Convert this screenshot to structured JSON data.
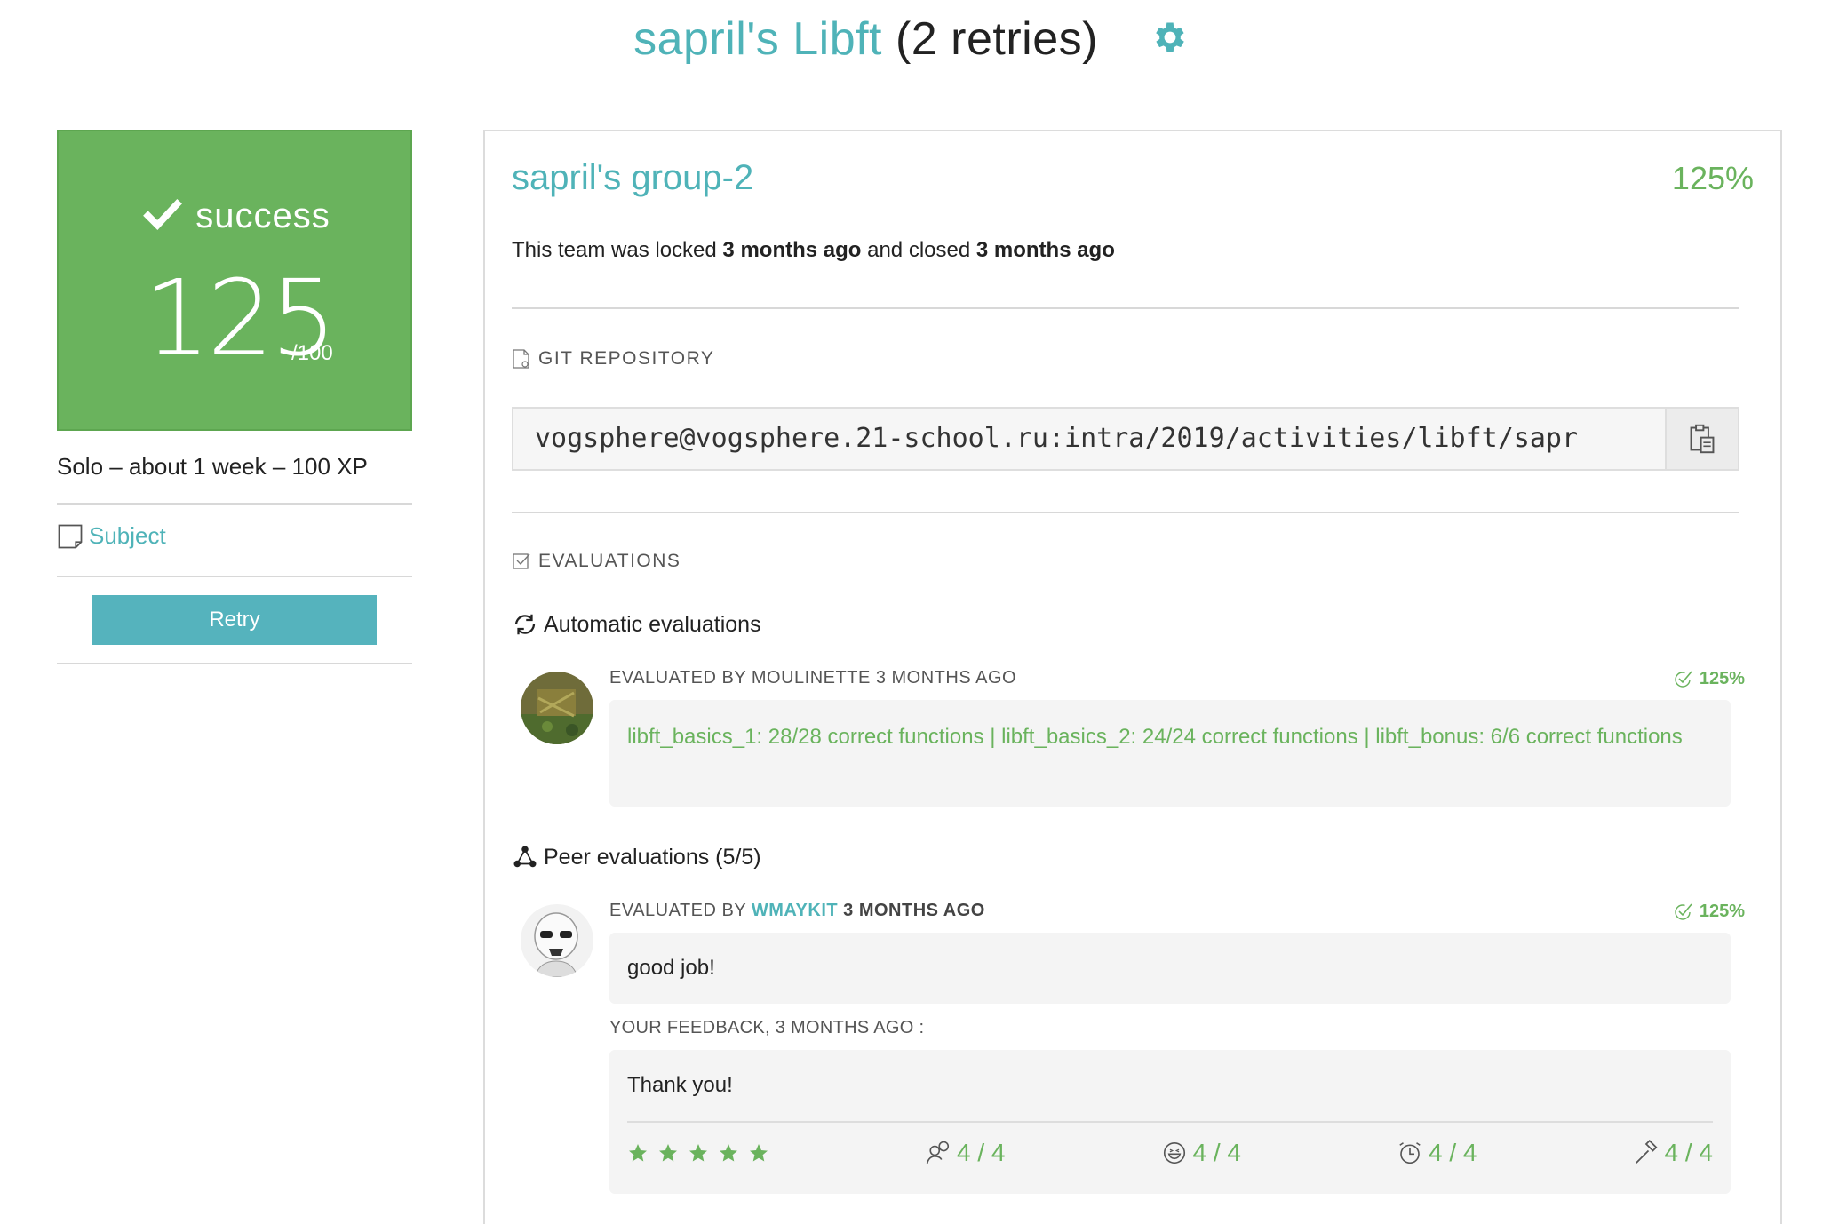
{
  "header": {
    "owner_project": "sapril's Libft",
    "retries": "(2 retries)"
  },
  "status_box": {
    "status": "success",
    "score": "125",
    "max": "/100"
  },
  "meta": "Solo – about 1 week – 100 XP",
  "subject_link": "Subject",
  "retry_button": "Retry",
  "team": {
    "name": "sapril's group-2",
    "percent": "125%",
    "locked_prefix": "This team was locked ",
    "locked_time": "3 months ago",
    "closed_prefix": " and closed ",
    "closed_time": "3 months ago"
  },
  "git": {
    "label": "GIT REPOSITORY",
    "url": "vogsphere@vogsphere.21-school.ru:intra/2019/activities/libft/sapr"
  },
  "evaluations": {
    "label": "EVALUATIONS",
    "automatic_title": "Automatic evaluations",
    "auto": {
      "header": "EVALUATED BY MOULINETTE 3 MONTHS AGO",
      "percent": "125%",
      "message": "libft_basics_1: 28/28 correct functions | libft_basics_2: 24/24 correct functions | libft_bonus: 6/6 correct functions"
    },
    "peer_title": "Peer evaluations (5/5)",
    "peer": {
      "header_prefix": "EVALUATED BY ",
      "login": "WMAYKIT",
      "time": " 3 MONTHS AGO",
      "percent": "125%",
      "message": "good job!",
      "feedback_label": "YOUR FEEDBACK, 3 MONTHS AGO :",
      "feedback_text": "Thank you!",
      "star_rating": 5,
      "ratings": [
        "4 / 4",
        "4 / 4",
        "4 / 4",
        "4 / 4"
      ]
    }
  },
  "colors": {
    "accent": "#4fb3b8",
    "success": "#6ab35d",
    "retry": "#55b3bd"
  },
  "icons": [
    "gear-icon",
    "check-icon",
    "document-icon",
    "git-file-icon",
    "checkbox-icon",
    "clipboard-icon",
    "refresh-icon",
    "network-icon",
    "check-circle-icon",
    "star-icon",
    "interested-icon",
    "smile-icon",
    "clock-icon",
    "hammer-icon"
  ]
}
